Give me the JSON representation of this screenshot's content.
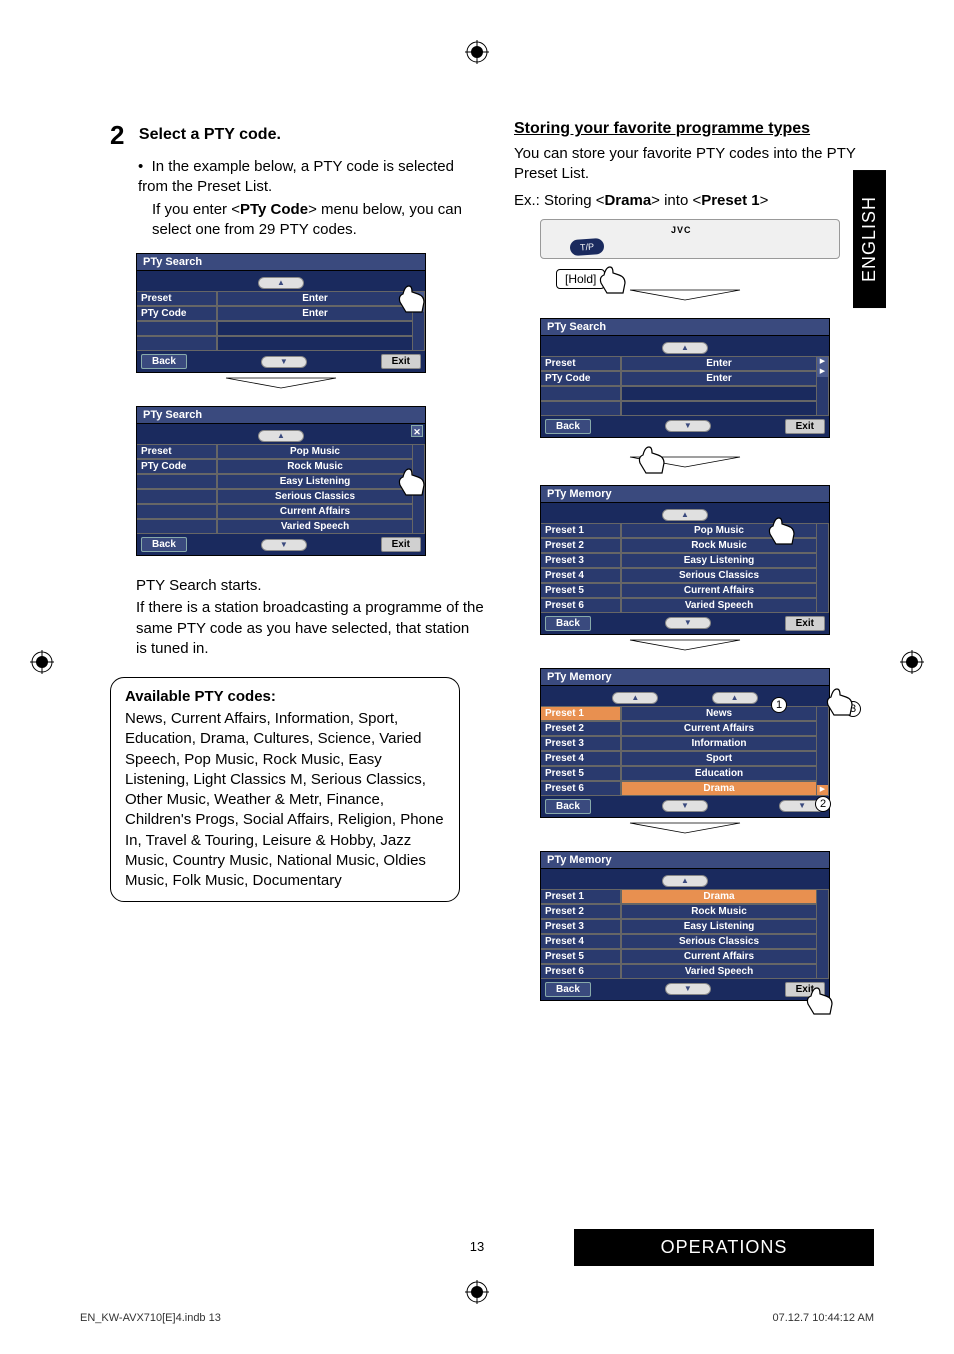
{
  "page": {
    "number": "13",
    "section_bar": "OPERATIONS",
    "lang_tab": "ENGLISH",
    "footer_left": "EN_KW-AVX710[E]4.indb   13",
    "footer_right": "07.12.7   10:44:12 AM"
  },
  "left": {
    "step_num": "2",
    "step_title": "Select a PTY code.",
    "bullet": "In the example below, a PTY code is selected from the Preset List.",
    "bullet_sub_pre": "If you enter <",
    "bullet_sub_bold": "PTy Code",
    "bullet_sub_post": "> menu below, you can select one from 29 PTY codes.",
    "panel1": {
      "title": "PTy Search",
      "rows": [
        {
          "left": "Preset",
          "right": "Enter"
        },
        {
          "left": "PTy Code",
          "right": "Enter"
        }
      ],
      "back": "Back",
      "exit": "Exit"
    },
    "panel2": {
      "title": "PTy Search",
      "left_rows": [
        "Preset",
        "PTy Code"
      ],
      "right_rows": [
        "Pop Music",
        "Rock Music",
        "Easy Listening",
        "Serious Classics",
        "Current Affairs",
        "Varied Speech"
      ],
      "back": "Back",
      "exit": "Exit"
    },
    "search_start": "PTY Search starts.",
    "search_body": "If there is a station broadcasting a programme of the same PTY code as you have selected, that station is tuned in.",
    "box_title": "Available PTY codes:",
    "box_body": "News, Current Affairs, Information, Sport, Education, Drama, Cultures, Science, Varied Speech, Pop Music, Rock Music, Easy Listening, Light Classics M, Serious Classics, Other Music, Weather & Metr, Finance, Children's Progs, Social Affairs, Religion, Phone In, Travel & Touring, Leisure & Hobby, Jazz Music, Country Music, National Music, Oldies Music, Folk Music, Documentary"
  },
  "right": {
    "heading": "Storing your favorite programme types",
    "body1": "You can store your favorite PTY codes into the PTY Preset List.",
    "body2_pre": "Ex.: Storing <",
    "body2_b1": "Drama",
    "body2_mid": "> into <",
    "body2_b2": "Preset 1",
    "body2_post": ">",
    "tp_label": "T/P",
    "hold": "[Hold]",
    "jvc": "JVC",
    "panel_search": {
      "title": "PTy Search",
      "rows": [
        {
          "left": "Preset",
          "right": "Enter"
        },
        {
          "left": "PTy Code",
          "right": "Enter"
        }
      ],
      "back": "Back",
      "exit": "Exit"
    },
    "panel_mem1": {
      "title": "PTy Memory",
      "rows": [
        {
          "left": "Preset 1",
          "right": "Pop Music"
        },
        {
          "left": "Preset 2",
          "right": "Rock Music"
        },
        {
          "left": "Preset 3",
          "right": "Easy Listening"
        },
        {
          "left": "Preset 4",
          "right": "Serious Classics"
        },
        {
          "left": "Preset 5",
          "right": "Current Affairs"
        },
        {
          "left": "Preset 6",
          "right": "Varied Speech"
        }
      ],
      "back": "Back",
      "exit": "Exit"
    },
    "panel_mem2": {
      "title": "PTy Memory",
      "rows_left": [
        "Preset 1",
        "Preset 2",
        "Preset 3",
        "Preset 4",
        "Preset 5",
        "Preset 6"
      ],
      "rows_right": [
        "News",
        "Current Affairs",
        "Information",
        "Sport",
        "Education",
        "Drama"
      ],
      "back": "Back"
    },
    "panel_mem3": {
      "title": "PTy Memory",
      "rows": [
        {
          "left": "Preset 1",
          "right": "Drama"
        },
        {
          "left": "Preset 2",
          "right": "Rock Music"
        },
        {
          "left": "Preset 3",
          "right": "Easy Listening"
        },
        {
          "left": "Preset 4",
          "right": "Serious Classics"
        },
        {
          "left": "Preset 5",
          "right": "Current Affairs"
        },
        {
          "left": "Preset 6",
          "right": "Varied Speech"
        }
      ],
      "back": "Back",
      "exit": "Exit"
    },
    "callouts": [
      "1",
      "2",
      "3"
    ]
  }
}
